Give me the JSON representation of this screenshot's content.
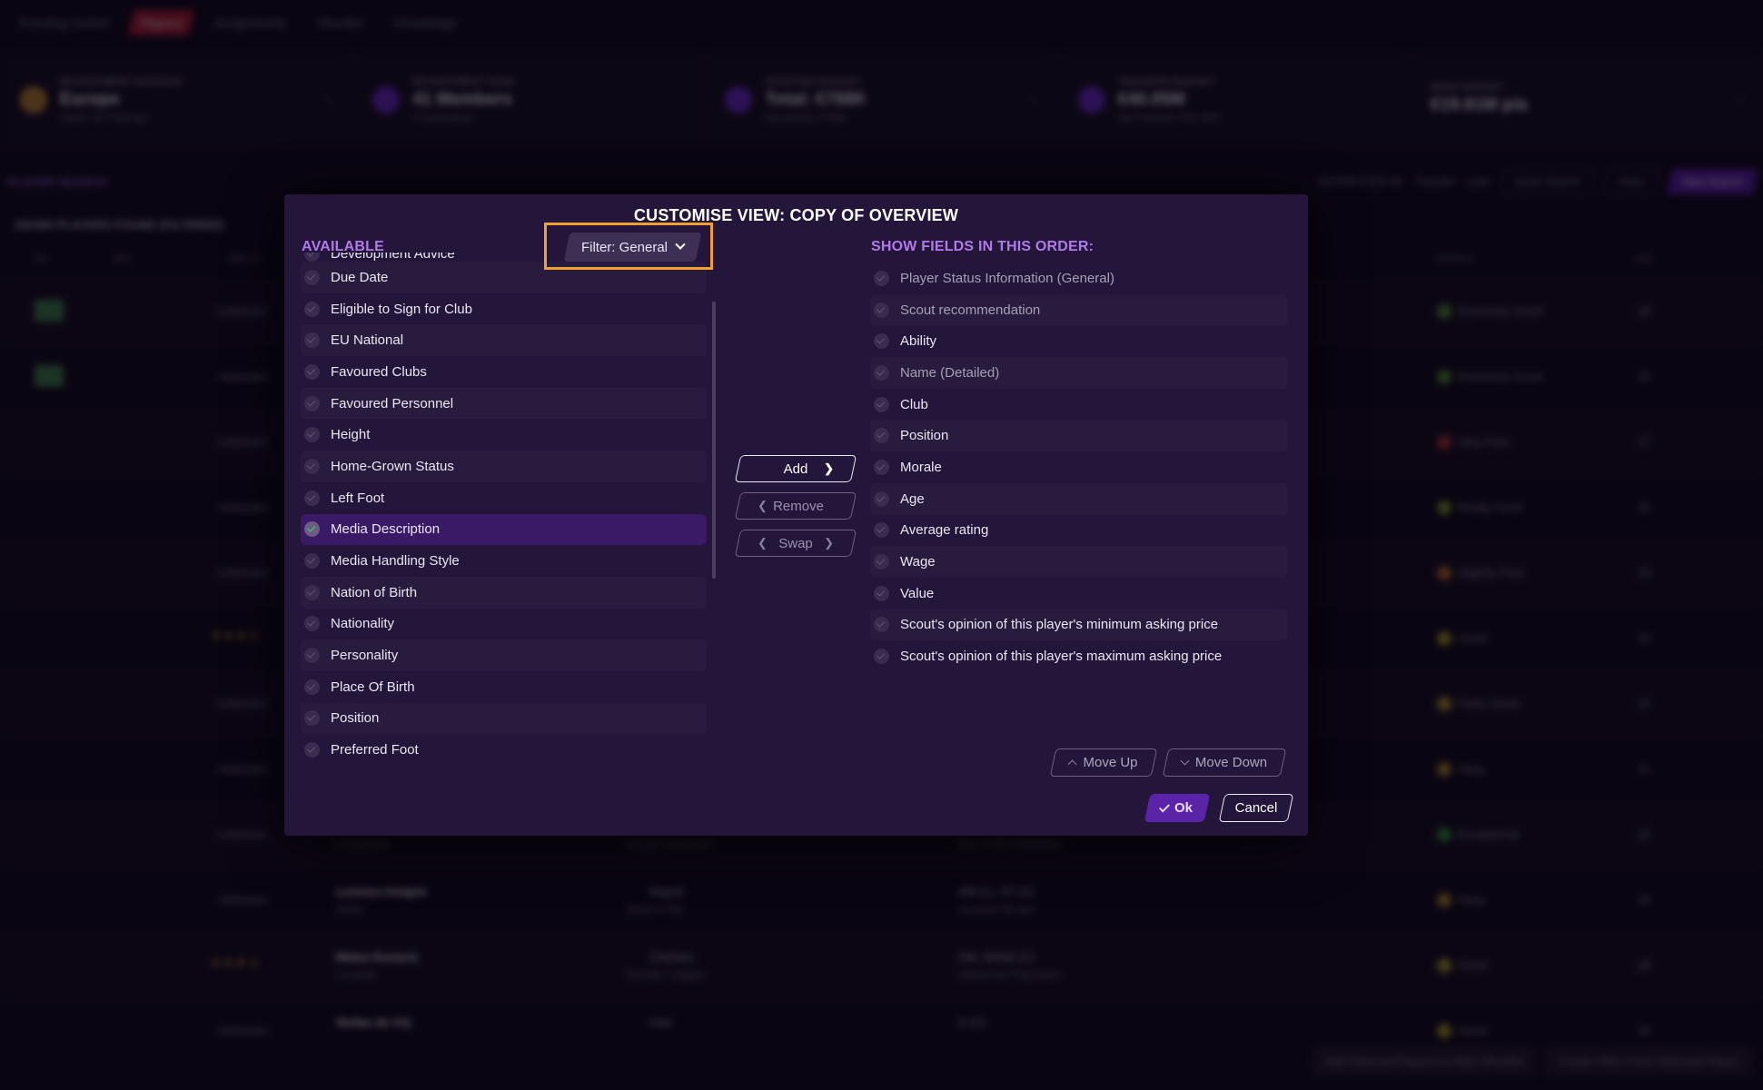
{
  "background": {
    "nav": [
      "Scouting Centre",
      "Players",
      "Assignments",
      "Shortlist",
      "Knowledge"
    ],
    "nav_active_index": 1,
    "cards": [
      {
        "label": "RECRUITMENT PACKAGE",
        "value": "Europe",
        "sub": "Upper Tier Package"
      },
      {
        "label": "RECRUITMENT TEAM",
        "value": "41 Members",
        "sub": "6 Unassigned"
      },
      {
        "label": "SCOUTING BUDGET",
        "value": "Total: €788K",
        "sub": "Remaining: €788K"
      },
      {
        "label": "TRANSFER BUDGET",
        "value": "€40.05M",
        "sub": "Next Season: €51.43M"
      },
      {
        "label": "WAGE BUDGET",
        "value": "€19.91M p/a",
        "sub": ""
      }
    ],
    "player_search_title": "PLAYER SEARCH",
    "interested_in_label": "INTERESTED IN:",
    "transfer_label": "Transfer",
    "loan_label": "Loan",
    "quick_search_label": "Quick Search",
    "clear_label": "Clear",
    "new_search_label": "New Search",
    "players_found": "180386 PLAYERS FOUND (FILTERED)",
    "columns": {
      "inf": "INF",
      "rec": "REC",
      "ability": "ABILITY",
      "morale": "MORALE",
      "age": "AGE"
    },
    "rows": [
      {
        "ability": "Unknown",
        "morale": "Extremely Good",
        "morale_color": "#4f9a2a",
        "age": "28",
        "name": "",
        "nat": "",
        "club": "",
        "league": "",
        "pos": "",
        "role": ""
      },
      {
        "ability": "Unknown",
        "morale": "Extremely Good",
        "morale_color": "#4f9a2a",
        "age": "25",
        "name": "",
        "nat": "",
        "club": "",
        "league": "",
        "pos": "",
        "role": ""
      },
      {
        "ability": "Unknown",
        "morale": "Very Poor",
        "morale_color": "#b0352a",
        "age": "17",
        "name": "",
        "nat": "",
        "club": "",
        "league": "",
        "pos": "",
        "role": ""
      },
      {
        "ability": "Unknown",
        "morale": "Really Good",
        "morale_color": "#7d9a20",
        "age": "25",
        "name": "",
        "nat": "",
        "club": "",
        "league": "",
        "pos": "",
        "role": ""
      },
      {
        "ability": "Unknown",
        "morale": "Slightly Poor",
        "morale_color": "#c0702a",
        "age": "23",
        "name": "",
        "nat": "",
        "club": "",
        "league": "",
        "pos": "",
        "role": ""
      },
      {
        "ability": "★★★½",
        "morale": "Good",
        "morale_color": "#a8a020",
        "age": "23",
        "name": "",
        "nat": "",
        "club": "",
        "league": "",
        "pos": "",
        "role": ""
      },
      {
        "ability": "Unknown",
        "morale": "Fairly Good",
        "morale_color": "#b09a25",
        "age": "22",
        "name": "",
        "nat": "",
        "club": "",
        "league": "",
        "pos": "",
        "role": ""
      },
      {
        "ability": "Unknown",
        "morale": "Okay",
        "morale_color": "#b08a25",
        "age": "21",
        "name": "",
        "nat": "",
        "club": "",
        "league": "",
        "pos": "",
        "role": ""
      },
      {
        "ability": "Unknown",
        "morale": "Exceptional",
        "morale_color": "#2a9a3a",
        "age": "22",
        "name": "",
        "nat": "Uruguayan",
        "club": "",
        "league": "LaLiga Santander",
        "pos": "",
        "role": "Box To Box Midfielder"
      },
      {
        "ability": "Unknown",
        "morale": "Okay",
        "morale_color": "#b08a25",
        "age": "29",
        "name": "Lorenzo Insigne",
        "nat": "Italian",
        "club": "Napoli",
        "league": "Serie A TIM",
        "pos": "AM (L), ST (C)",
        "role": "Inverted Winger"
      },
      {
        "ability": "★★★½",
        "morale": "Good",
        "morale_color": "#a8a020",
        "age": "28",
        "name": "Mateo Kovacic",
        "nat": "Croatian",
        "club": "Chelsea",
        "league": "Premier League",
        "pos": "DM, M/AM (C)",
        "role": "Advanced Playmaker"
      },
      {
        "ability": "Unknown",
        "morale": "Good",
        "morale_color": "#a8a020",
        "age": "29",
        "name": "Stefan de Vrij",
        "nat": "",
        "club": "Inter",
        "league": "",
        "pos": "D (C)",
        "role": ""
      }
    ],
    "bottom_actions": [
      "Add Selected Players to New Shortlist",
      "Create Filter From Selected Player"
    ]
  },
  "modal": {
    "title": "CUSTOMISE VIEW: COPY OF OVERVIEW",
    "available_title": "AVAILABLE",
    "show_title": "SHOW FIELDS IN THIS ORDER:",
    "filter_label": "Filter: General",
    "available_items": [
      {
        "label": "Development Advice",
        "selected": false,
        "partial": true
      },
      {
        "label": "Due Date",
        "selected": false
      },
      {
        "label": "Eligible to Sign for Club",
        "selected": false
      },
      {
        "label": "EU National",
        "selected": false
      },
      {
        "label": "Favoured Clubs",
        "selected": false
      },
      {
        "label": "Favoured Personnel",
        "selected": false
      },
      {
        "label": "Height",
        "selected": false
      },
      {
        "label": "Home-Grown Status",
        "selected": false
      },
      {
        "label": "Left Foot",
        "selected": false
      },
      {
        "label": "Media Description",
        "selected": true
      },
      {
        "label": "Media Handling Style",
        "selected": false
      },
      {
        "label": "Nation of Birth",
        "selected": false
      },
      {
        "label": "Nationality",
        "selected": false
      },
      {
        "label": "Personality",
        "selected": false
      },
      {
        "label": "Place Of Birth",
        "selected": false
      },
      {
        "label": "Position",
        "selected": false
      },
      {
        "label": "Preferred Foot",
        "selected": false
      }
    ],
    "shown_items": [
      {
        "label": "Player Status Information (General)",
        "locked": true
      },
      {
        "label": "Scout recommendation",
        "locked": true
      },
      {
        "label": "Ability",
        "locked": false
      },
      {
        "label": "Name (Detailed)",
        "locked": true
      },
      {
        "label": "Club",
        "locked": false
      },
      {
        "label": "Position",
        "locked": false
      },
      {
        "label": "Morale",
        "locked": false
      },
      {
        "label": "Age",
        "locked": false
      },
      {
        "label": "Average rating",
        "locked": false
      },
      {
        "label": "Wage",
        "locked": false
      },
      {
        "label": "Value",
        "locked": false
      },
      {
        "label": "Scout's opinion of this player's minimum asking price",
        "locked": false
      },
      {
        "label": "Scout's opinion of this player's maximum asking price",
        "locked": false
      }
    ],
    "buttons": {
      "add": "Add",
      "remove": "Remove",
      "swap": "Swap",
      "move_up": "Move Up",
      "move_down": "Move Down",
      "ok": "Ok",
      "cancel": "Cancel"
    }
  }
}
